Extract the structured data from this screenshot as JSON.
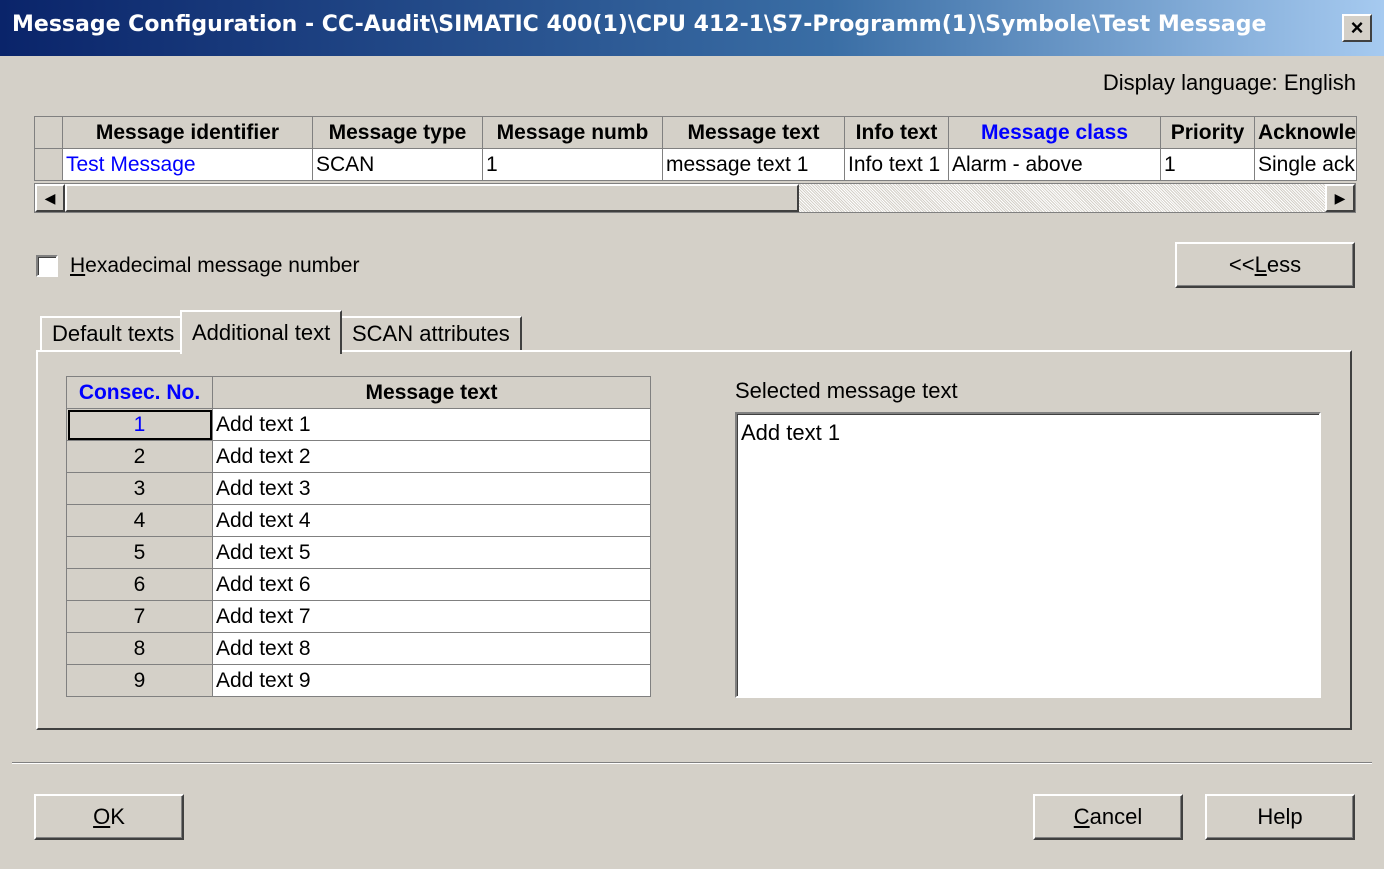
{
  "window": {
    "title": "Message Configuration - CC-Audit\\SIMATIC 400(1)\\CPU 412-1\\S7-Programm(1)\\Symbole\\Test Message",
    "close_glyph": "×"
  },
  "display_language": "Display language: English",
  "message_grid": {
    "headers": [
      "Message identifier",
      "Message type",
      "Message numb",
      "Message text",
      "Info text",
      "Message class",
      "Priority",
      "Acknowled"
    ],
    "row": [
      "Test Message",
      "SCAN",
      "1",
      "message text 1",
      "Info text 1",
      "Alarm - above",
      "1",
      "Single ackno"
    ]
  },
  "hex_checkbox": {
    "label_u": "H",
    "label_rest": "exadecimal message number",
    "checked": false
  },
  "less_button": {
    "prefix": "<<",
    "u": "L",
    "rest": "ess"
  },
  "tabs": [
    "Default texts",
    "Additional text",
    "SCAN attributes"
  ],
  "additional_text": {
    "col_no": "Consec. No.",
    "col_text": "Message text",
    "rows": [
      {
        "no": "1",
        "text": "Add text 1"
      },
      {
        "no": "2",
        "text": "Add text 2"
      },
      {
        "no": "3",
        "text": "Add text 3"
      },
      {
        "no": "4",
        "text": "Add text 4"
      },
      {
        "no": "5",
        "text": "Add text 5"
      },
      {
        "no": "6",
        "text": "Add text 6"
      },
      {
        "no": "7",
        "text": "Add text 7"
      },
      {
        "no": "8",
        "text": "Add text 8"
      },
      {
        "no": "9",
        "text": "Add text 9"
      }
    ],
    "selected_label": "Selected message text",
    "selected_value": "Add text 1"
  },
  "buttons": {
    "ok_u": "O",
    "ok_rest": "K",
    "cancel_u": "C",
    "cancel_rest": "ancel",
    "help": "Help"
  }
}
